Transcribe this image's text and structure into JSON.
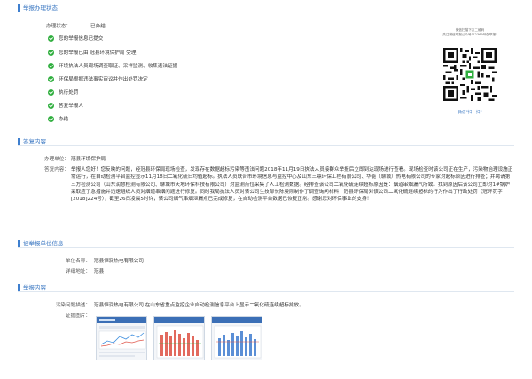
{
  "sections": {
    "status": "举报办理状态",
    "reply": "答复内容",
    "reported": "被举报单位信息",
    "report": "举报内容"
  },
  "status": {
    "label": "办理状态：",
    "value": "已办结",
    "steps": [
      "您的举报信息已提交",
      "您的举报已由 冠县环境保护局 受理",
      "环境执法人员现场调查取证、采样监测、收集违法证据",
      "环保局根据违法事实审议并作出处罚决定",
      "执行处罚",
      "答复举报人",
      "办结"
    ]
  },
  "qr": {
    "top1": "微信扫描下方二维码",
    "top2": "关注微信举报公众号\"12369环保举报\"",
    "bottom": "微信\"扫一扫\""
  },
  "reply": {
    "unit_label": "办理单位：",
    "unit_value": "冠县环境保护局",
    "content_label": "答复内容：",
    "content": "举报人您好！您反映的问题，经冠县环保局现场检查，发现存在数据超标污染等违法问题2018年11月19日执法人员接群众举报后立即到达现场进行查看。现场检查时该公司正在生产，污染物治理设施正常运行，在自动检测平台监控显示11月18日二氧化硫日均值超标。执法人员联合市环境信息与监控中心及山东三鼎环保工程有限公司、华能（聊城）热电有限公司的专家对超标原因进行排查；并聘请第三方检测公司（山东润慧检测有限公司、聊城市天地环保科技有限公司）对监测点位采集了人工检测数据。经排查该公司二氧化硫连续超标原因是：烟道串烟漏气所致。找到原因后该公司立即对1#锅炉采取应了急措施并迅速组织人员对烟道串烟问题进行修复。同时我局执法人员对该公司生技部长陈曼刚制作了调查询问材料，冠县环保局对该公司二氧化硫连续超标的行为作出了行政处罚（冠环罚字[2018]224号），截至26日凌晨5时许，该公司烟气串烟泄漏点已完成修复，在自动检测平台数据已恢复正常。感谢您对环保事业的支持！"
  },
  "reported": {
    "unit_label": "单位名称：",
    "unit_value": "冠县恒润热电有限公司",
    "address_label": "详细地址：",
    "address_value": "冠县"
  },
  "report": {
    "problem_label": "污染问题描述：",
    "problem_value": "冠县恒润热电有限公司 在山东省重点监控企业自动检测信息平台上显示二氧化硫连续超标排放。",
    "images_label": "证据图片："
  }
}
